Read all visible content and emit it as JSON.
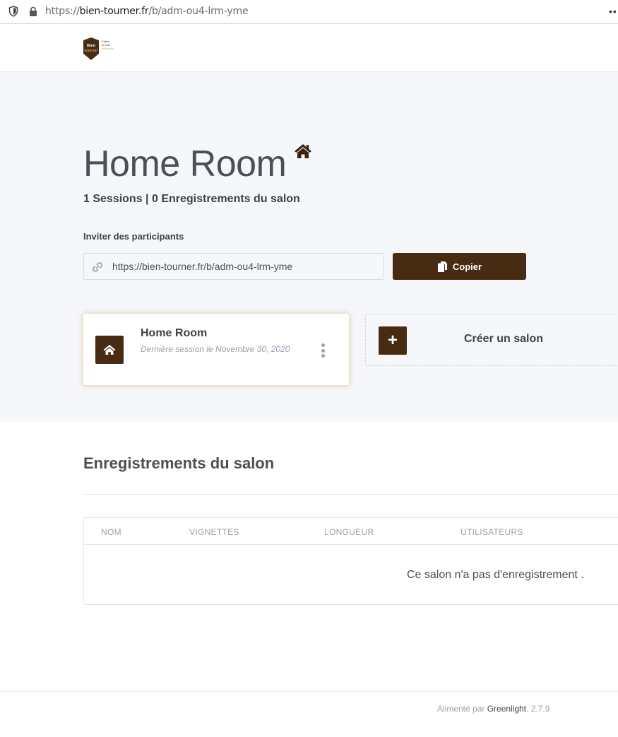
{
  "browser": {
    "url_prefix": "https://",
    "url_domain": "bien-tourner.fr",
    "url_path": "/b/adm-ou4-lrm-yme",
    "more": "••"
  },
  "room": {
    "title": "Home Room",
    "stats": "1 Sessions | 0 Enregistrements du salon",
    "invite_label": "Inviter des participants",
    "invite_url": "https://bien-tourner.fr/b/adm-ou4-lrm-yme",
    "copy_label": "Copier"
  },
  "room_card": {
    "title": "Home Room",
    "subtitle": "Dernière session le Novembre 30, 2020"
  },
  "create_room": {
    "label": "Créer un salon",
    "plus": "+"
  },
  "recordings": {
    "title": "Enregistrements du salon",
    "columns": [
      "NOM",
      "VIGNETTES",
      "LONGUEUR",
      "UTILISATEURS"
    ],
    "empty_message": "Ce salon n'a pas d'enregistrement ."
  },
  "footer": {
    "powered_by": "Alimenté par ",
    "brand": "Greenlight",
    "version": ". 2.7.9"
  },
  "colors": {
    "brand": "#472b13",
    "hero_bg": "#f5f7fb",
    "text": "#495057",
    "muted": "#9aa0ac"
  },
  "icons": {
    "title": "home-icon",
    "invite": "link-icon",
    "copy": "copy-icon",
    "card": "home-icon",
    "menu": "kebab-menu-icon"
  }
}
